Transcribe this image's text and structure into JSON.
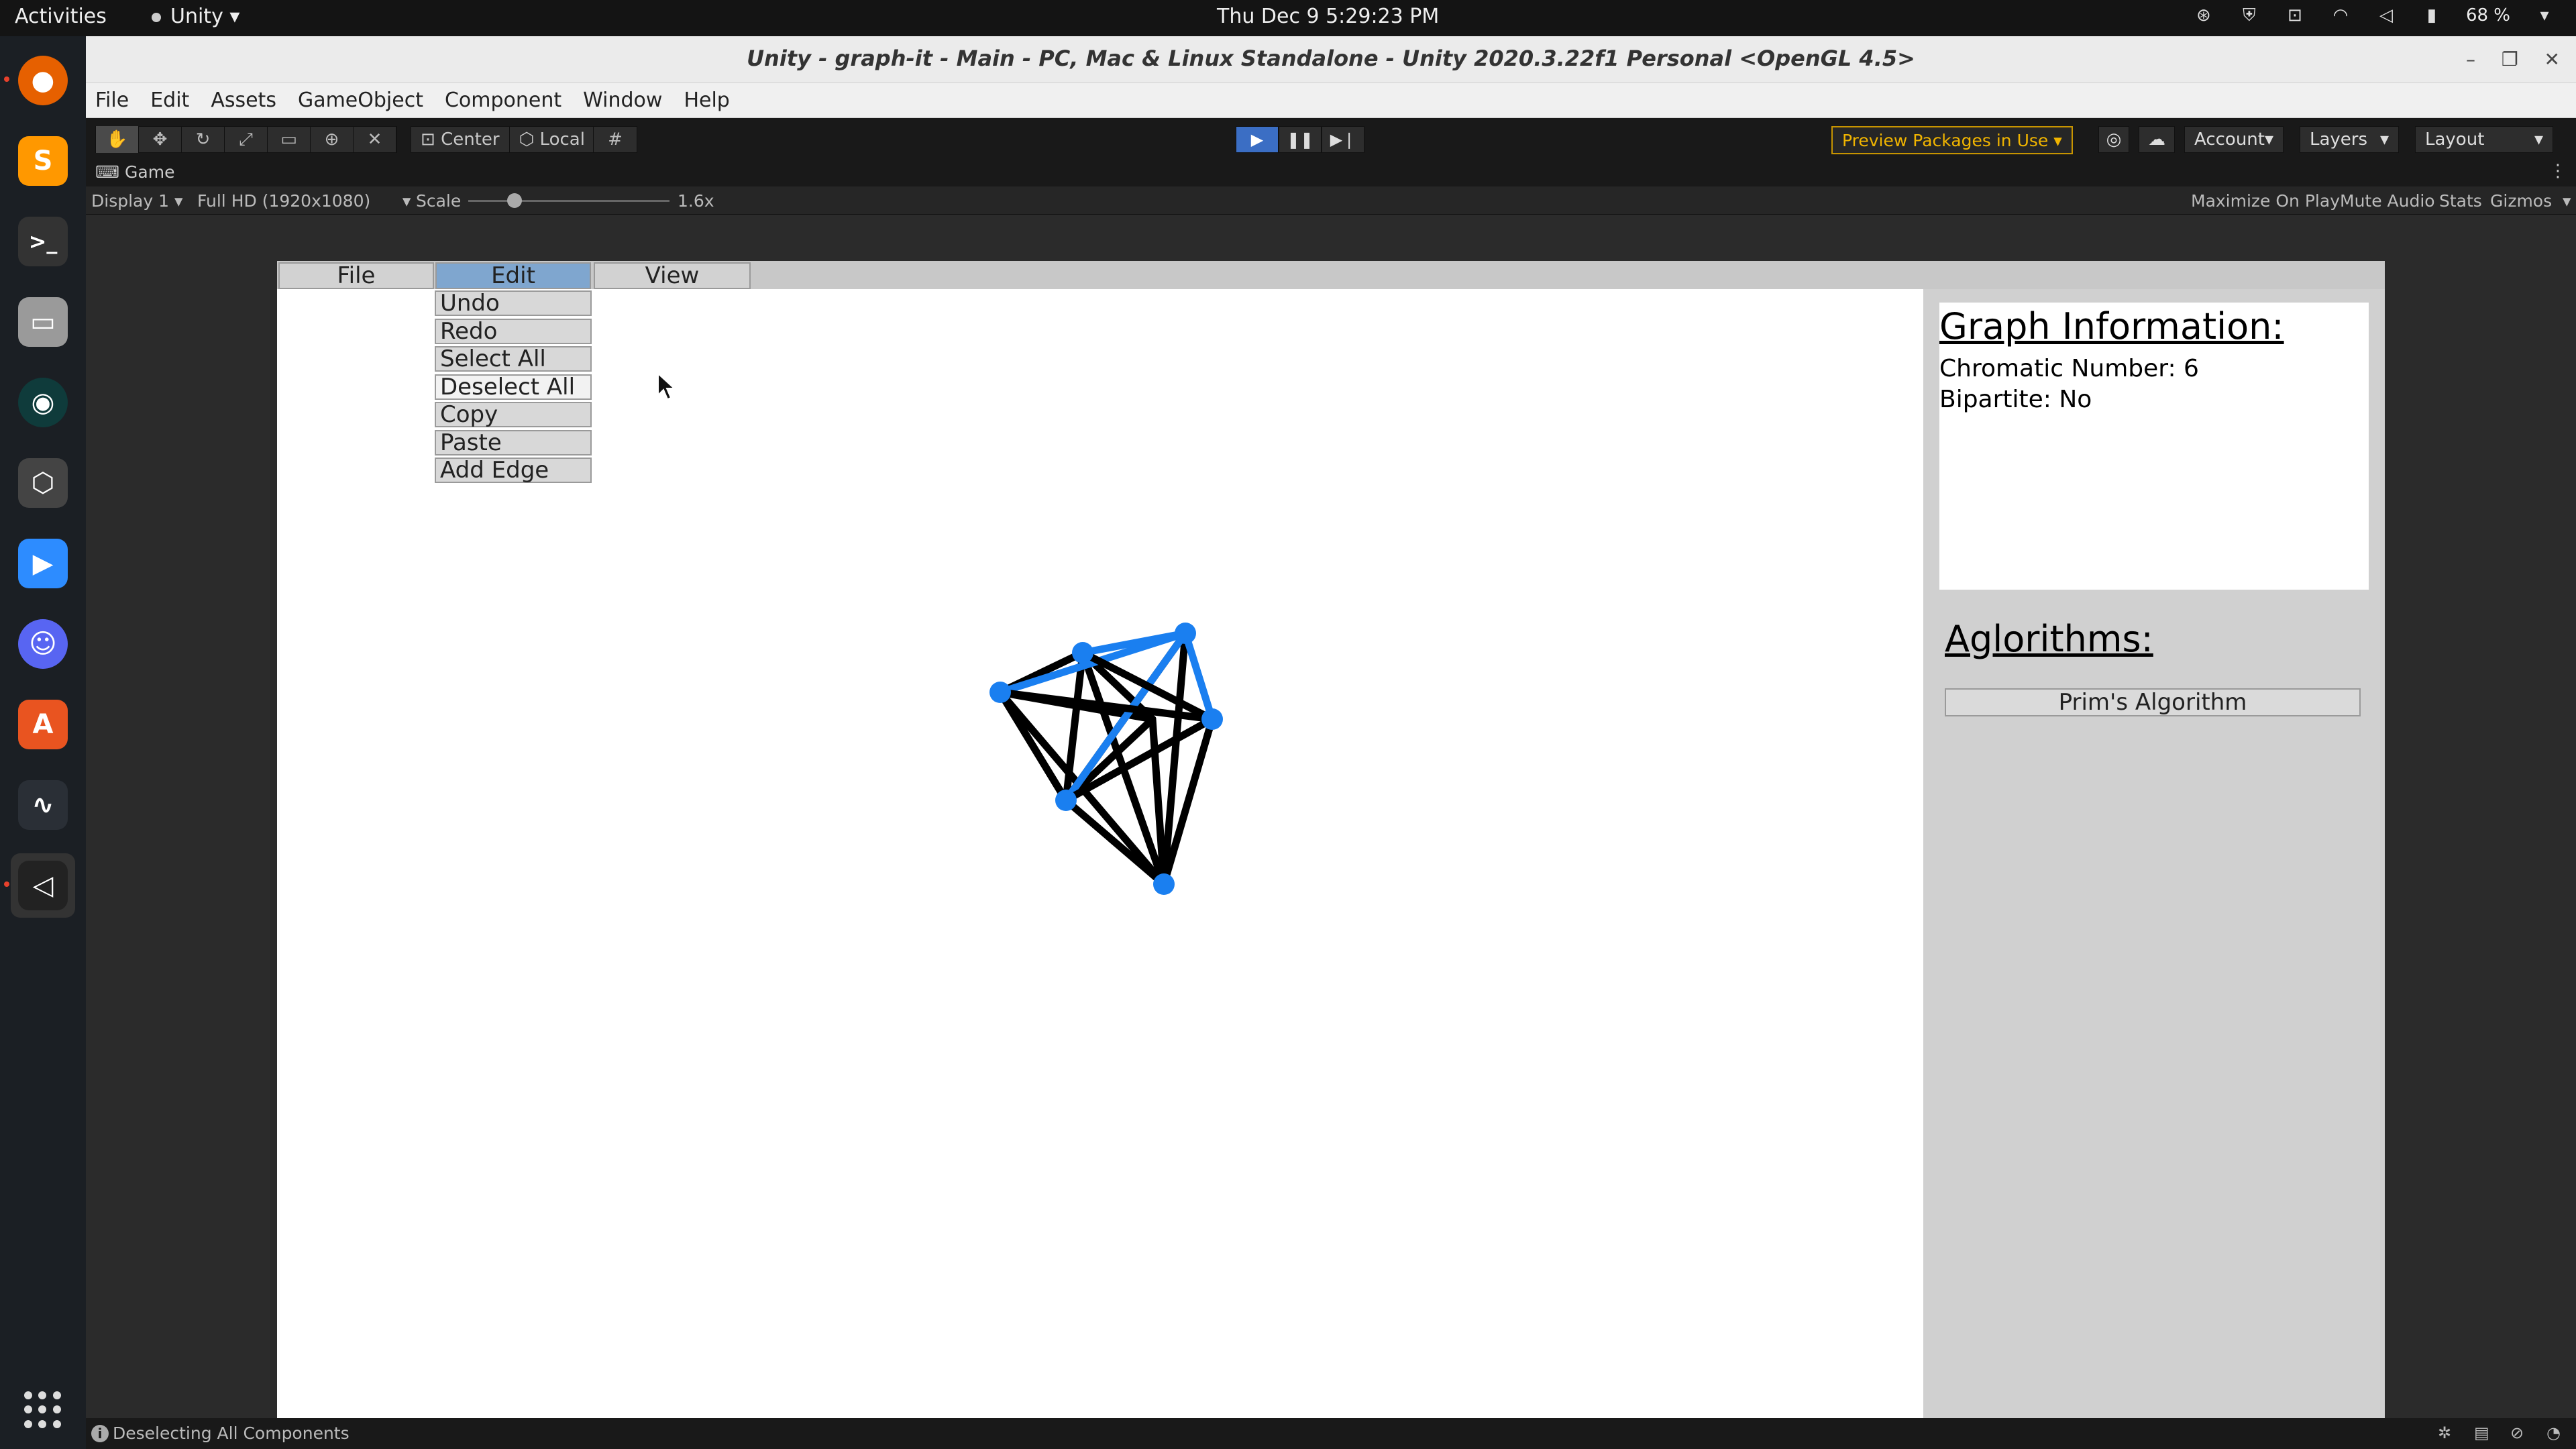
{
  "topbar": {
    "activities": "Activities",
    "app_name": "Unity",
    "clock": "Thu Dec 9  5:29:23 PM",
    "battery": "68 %"
  },
  "dock": {
    "items": [
      "firefox-icon",
      "sublime-text-icon",
      "terminal-icon",
      "files-icon",
      "gitkraken-icon",
      "unity-hub-icon",
      "zoom-icon",
      "discord-icon",
      "app-store-icon",
      "system-monitor-icon",
      "unity-editor-icon"
    ]
  },
  "window": {
    "title": "Unity - graph-it - Main - PC, Mac & Linux Standalone - Unity 2020.3.22f1 Personal <OpenGL 4.5>",
    "menu": [
      "File",
      "Edit",
      "Assets",
      "GameObject",
      "Component",
      "Window",
      "Help"
    ]
  },
  "toolbar": {
    "center_label": "Center",
    "local_label": "Local",
    "preview_packages": "Preview Packages in Use",
    "account": "Account",
    "layers": "Layers",
    "layout": "Layout"
  },
  "game_view": {
    "tab_label": "Game",
    "display": "Display 1",
    "resolution": "Full HD (1920x1080)",
    "scale_label": "Scale",
    "scale_value": "1.6x",
    "maximize": "Maximize On Play",
    "mute": "Mute Audio",
    "stats": "Stats",
    "gizmos": "Gizmos"
  },
  "app": {
    "menu": {
      "file": "File",
      "edit": "Edit",
      "view": "View"
    },
    "edit_dropdown": [
      "Undo",
      "Redo",
      "Select All",
      "Deselect All",
      "Copy",
      "Paste",
      "Add Edge"
    ],
    "graph_info": {
      "heading": "Graph Information:",
      "chromatic": "Chromatic Number: 6",
      "bipartite": "Bipartite: No"
    },
    "algorithms": {
      "heading": "Aglorithms:",
      "prim": "Prim's Algorithm"
    }
  },
  "colors": {
    "node": "#1a7ff0",
    "highlight_edge": "#1a7ff0",
    "edge": "#000000"
  },
  "status": {
    "message": "Deselecting All Components"
  }
}
